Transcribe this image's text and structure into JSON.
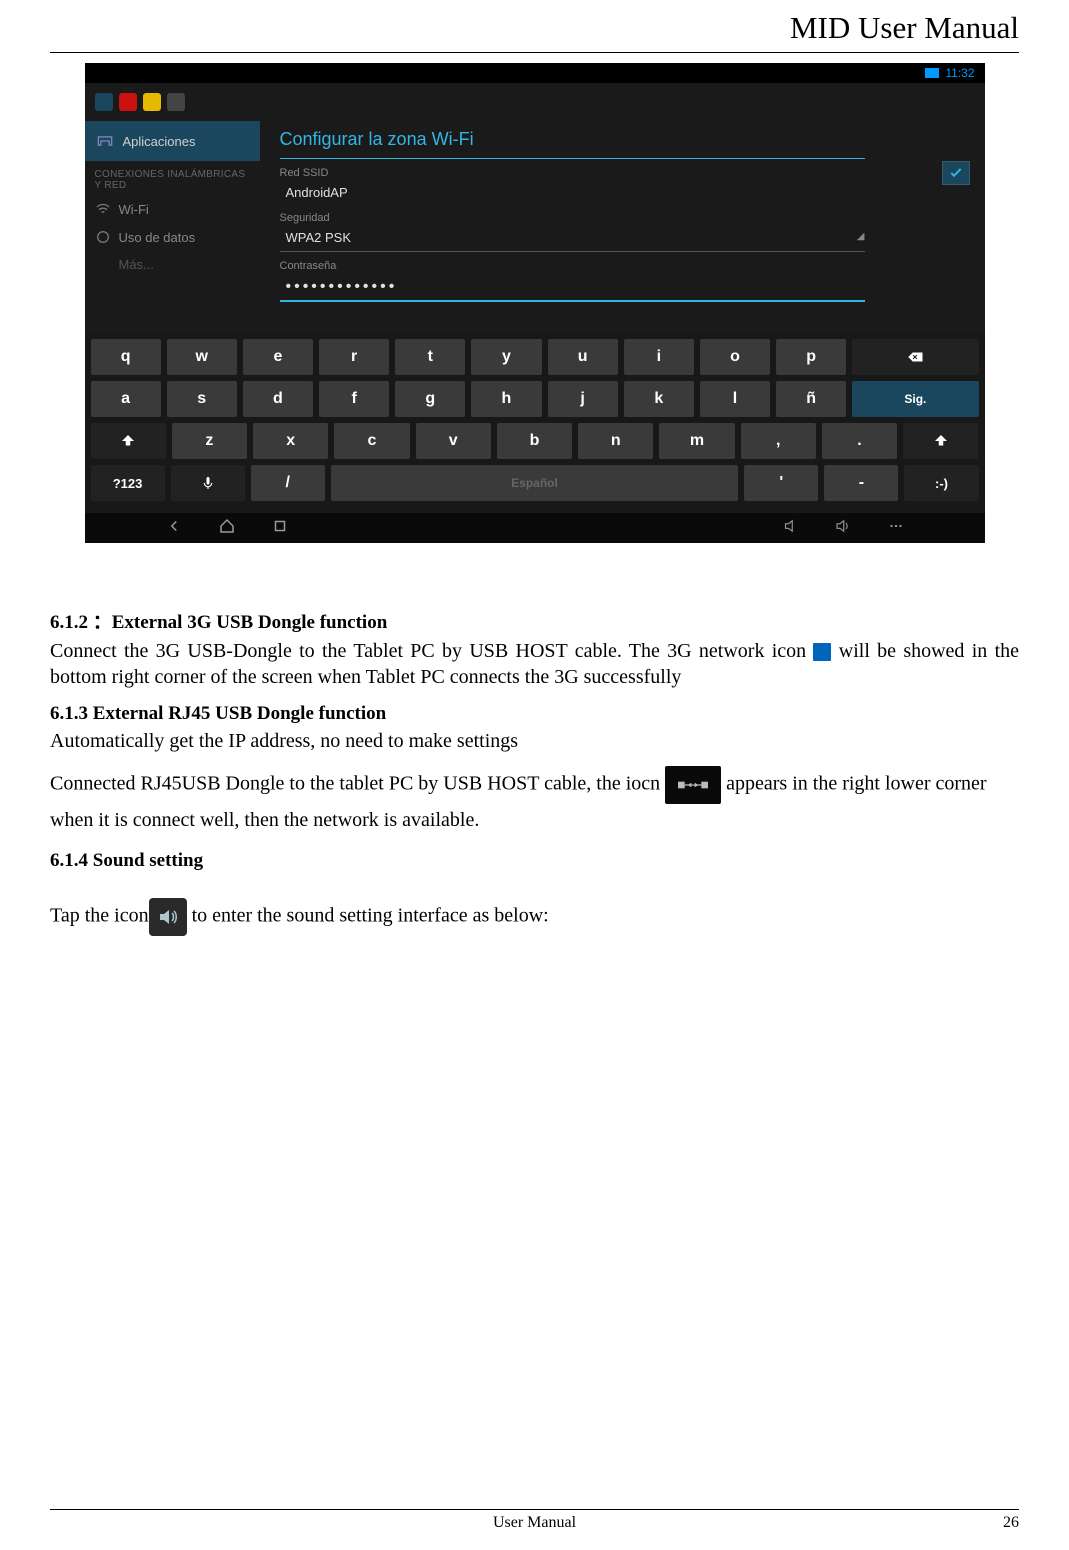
{
  "header": {
    "title": "MID User Manual"
  },
  "screenshot": {
    "status": {
      "time": "11:32"
    },
    "sidebar": {
      "top": "Aplicaciones",
      "section": "CONEXIONES INALÁMBRICAS Y RED",
      "items": [
        "Wi-Fi",
        "Uso de datos",
        "Más..."
      ]
    },
    "dialog": {
      "title": "Configurar la zona Wi-Fi",
      "ssid_label": "Red SSID",
      "ssid_value": "AndroidAP",
      "security_label": "Seguridad",
      "security_value": "WPA2 PSK",
      "password_label": "Contraseña",
      "password_value": "•••••••••••••"
    },
    "keyboard": {
      "row1": [
        "q",
        "w",
        "e",
        "r",
        "t",
        "y",
        "u",
        "i",
        "o",
        "p"
      ],
      "row2": [
        "a",
        "s",
        "d",
        "f",
        "g",
        "h",
        "j",
        "k",
        "l",
        "ñ"
      ],
      "row3": [
        "z",
        "x",
        "c",
        "v",
        "b",
        "n",
        "m",
        ",",
        "."
      ],
      "sig": "Sig.",
      "numkey": "?123",
      "slash": "/",
      "space": "Español",
      "apos": "'",
      "dash": "-",
      "smiley": ":-)"
    }
  },
  "sections": {
    "s612_title": "6.1.2 ：External 3G USB Dongle function",
    "s612_body_a": "Connect the 3G USB-Dongle to the Tablet PC by USB HOST cable. The 3G network icon ",
    "s612_body_b": " will be showed in the bottom right corner of the screen when Tablet PC connects the 3G successfully",
    "s613_title": "6.1.3 External RJ45 USB Dongle function",
    "s613_body1": "Automatically get the IP address, no need to make settings",
    "s613_body2a": "Connected RJ45USB Dongle to the tablet PC by USB HOST cable, the iocn ",
    "s613_body2b": " appears in the right lower corner when it is connect well, then the network is available.",
    "s614_title": "6.1.4 Sound setting",
    "s614_body_a": "Tap the icon",
    "s614_body_b": "  to enter the sound setting interface as below:"
  },
  "footer": {
    "text": "User Manual",
    "page": "26"
  }
}
